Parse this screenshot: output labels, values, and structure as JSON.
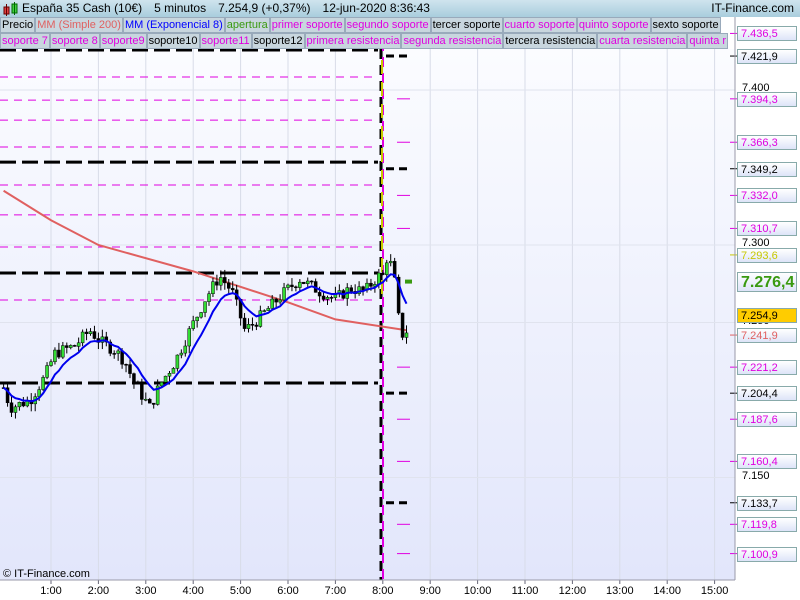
{
  "header": {
    "instrument": "España 35 Cash (10€)",
    "timeframe": "5 minutos",
    "price": "7.254,9 (+0,37%)",
    "datetime": "12-jun-2020 8:36:43",
    "brand": "IT-Finance.com"
  },
  "legend_row1": [
    {
      "label": "Precio",
      "color": "#000000"
    },
    {
      "label": "MM (Simple 200)",
      "color": "#e06060"
    },
    {
      "label": "MM (Exponencial 8)",
      "color": "#0000ff"
    },
    {
      "label": "apertura",
      "color": "#3a9a10"
    },
    {
      "label": "primer soporte",
      "color": "#e000e0"
    },
    {
      "label": "segundo soporte",
      "color": "#e000e0"
    },
    {
      "label": "tercer soporte",
      "color": "#000000"
    },
    {
      "label": "cuarto soporte",
      "color": "#e000e0"
    },
    {
      "label": "quinto soporte",
      "color": "#e000e0"
    },
    {
      "label": "sexto soporte",
      "color": "#000000"
    }
  ],
  "legend_row2": [
    {
      "label": "soporte 7",
      "color": "#e000e0"
    },
    {
      "label": "soporte 8",
      "color": "#e000e0"
    },
    {
      "label": "soporte9",
      "color": "#e000e0"
    },
    {
      "label": "soporte10",
      "color": "#000000"
    },
    {
      "label": "soporte11",
      "color": "#e000e0"
    },
    {
      "label": "soporte12",
      "color": "#000000"
    },
    {
      "label": "primera resistencia",
      "color": "#e000e0"
    },
    {
      "label": "segunda resistencia",
      "color": "#e000e0"
    },
    {
      "label": "tercera resistencia",
      "color": "#000000"
    },
    {
      "label": "cuarta resistencia",
      "color": "#e000e0"
    },
    {
      "label": "quinta r",
      "color": "#e000e0"
    }
  ],
  "copyright": "© IT-Finance.com",
  "chart_data": {
    "type": "candlestick",
    "x_ticks": [
      "1:00",
      "2:00",
      "3:00",
      "4:00",
      "5:00",
      "6:00",
      "7:00",
      "8:00",
      "9:00",
      "10:00",
      "11:00",
      "12:00",
      "13:00",
      "14:00",
      "15:00"
    ],
    "y_ticks": [
      "7.400",
      "7.300",
      "7.250",
      "7.150"
    ],
    "ylim": [
      7090,
      7445
    ],
    "xlim_hours": [
      -0.08,
      15.45
    ],
    "price_path": [
      [
        0,
        7208
      ],
      [
        0.14,
        7195
      ],
      [
        0.56,
        7200
      ],
      [
        0.87,
        7215
      ],
      [
        1.08,
        7230
      ],
      [
        1.5,
        7235
      ],
      [
        1.82,
        7245
      ],
      [
        2.03,
        7238
      ],
      [
        2.35,
        7232
      ],
      [
        2.56,
        7225
      ],
      [
        2.77,
        7210
      ],
      [
        3.09,
        7195
      ],
      [
        3.3,
        7210
      ],
      [
        3.62,
        7225
      ],
      [
        3.93,
        7245
      ],
      [
        4.25,
        7265
      ],
      [
        4.56,
        7280
      ],
      [
        4.82,
        7270
      ],
      [
        5.09,
        7245
      ],
      [
        5.3,
        7250
      ],
      [
        5.62,
        7260
      ],
      [
        5.94,
        7270
      ],
      [
        6.25,
        7278
      ],
      [
        6.67,
        7270
      ],
      [
        6.99,
        7265
      ],
      [
        7.31,
        7272
      ],
      [
        7.62,
        7270
      ],
      [
        7.9,
        7280
      ],
      [
        8.0,
        7280
      ],
      [
        8.11,
        7295
      ],
      [
        8.26,
        7275
      ],
      [
        8.36,
        7245
      ],
      [
        8.47,
        7240
      ],
      [
        8.57,
        7255
      ]
    ],
    "sma200": [
      [
        0,
        7335
      ],
      [
        1,
        7316
      ],
      [
        2,
        7300
      ],
      [
        4,
        7283
      ],
      [
        6,
        7263
      ],
      [
        7,
        7252
      ],
      [
        8.5,
        7245
      ]
    ],
    "prev_levels": [
      {
        "p": 7425.8,
        "c": "#000000"
      },
      {
        "p": 7408.4,
        "c": "#e000e0"
      },
      {
        "p": 7393.5,
        "c": "#e000e0"
      },
      {
        "p": 7380.6,
        "c": "#e000e0"
      },
      {
        "p": 7363.2,
        "c": "#e000e0"
      },
      {
        "p": 7353.5,
        "c": "#000000"
      },
      {
        "p": 7338.7,
        "c": "#e000e0"
      },
      {
        "p": 7319.4,
        "c": "#e000e0"
      },
      {
        "p": 7298.7,
        "c": "#e000e0"
      },
      {
        "p": 7281.9,
        "c": "#000000"
      },
      {
        "p": 7264.5,
        "c": "#e000e0"
      },
      {
        "p": 7211.0,
        "c": "#000000"
      }
    ],
    "levels": [
      {
        "label": "7.436,5",
        "p": 7436.5,
        "c": "#e000e0",
        "stub": false
      },
      {
        "label": "7.421,9",
        "p": 7421.9,
        "c": "#000000",
        "stub": true
      },
      {
        "label": "7.394,3",
        "p": 7394.3,
        "c": "#e000e0",
        "stub": true
      },
      {
        "label": "7.366,3",
        "p": 7366.3,
        "c": "#e000e0",
        "stub": true
      },
      {
        "label": "7.349,2",
        "p": 7349.2,
        "c": "#000000",
        "stub": true
      },
      {
        "label": "7.332,0",
        "p": 7332.0,
        "c": "#e000e0",
        "stub": true
      },
      {
        "label": "7.310,7",
        "p": 7310.7,
        "c": "#e000e0",
        "stub": true
      },
      {
        "label": "7.293,6",
        "p": 7293.6,
        "c": "#c8c800",
        "stub": false
      },
      {
        "label": "7.241,9",
        "p": 7241.9,
        "c": "#e06060",
        "stub": false
      },
      {
        "label": "7.221,2",
        "p": 7221.2,
        "c": "#e000e0",
        "stub": true
      },
      {
        "label": "7.204,4",
        "p": 7204.4,
        "c": "#000000",
        "stub": true
      },
      {
        "label": "7.187,6",
        "p": 7187.6,
        "c": "#e000e0",
        "stub": true
      },
      {
        "label": "7.160,4",
        "p": 7160.4,
        "c": "#e000e0",
        "stub": true
      },
      {
        "label": "7.133,7",
        "p": 7133.7,
        "c": "#000000",
        "stub": true
      },
      {
        "label": "7.119,8",
        "p": 7119.8,
        "c": "#e000e0",
        "stub": true
      },
      {
        "label": "7.100,9",
        "p": 7100.9,
        "c": "#e000e0",
        "stub": true
      }
    ],
    "open_label": {
      "label": "7.276,4",
      "p": 7276.4,
      "c": "#3a9a10"
    },
    "last_label": {
      "label": "7.254,9",
      "p": 7254.9,
      "bg": "#ffcc00"
    }
  }
}
